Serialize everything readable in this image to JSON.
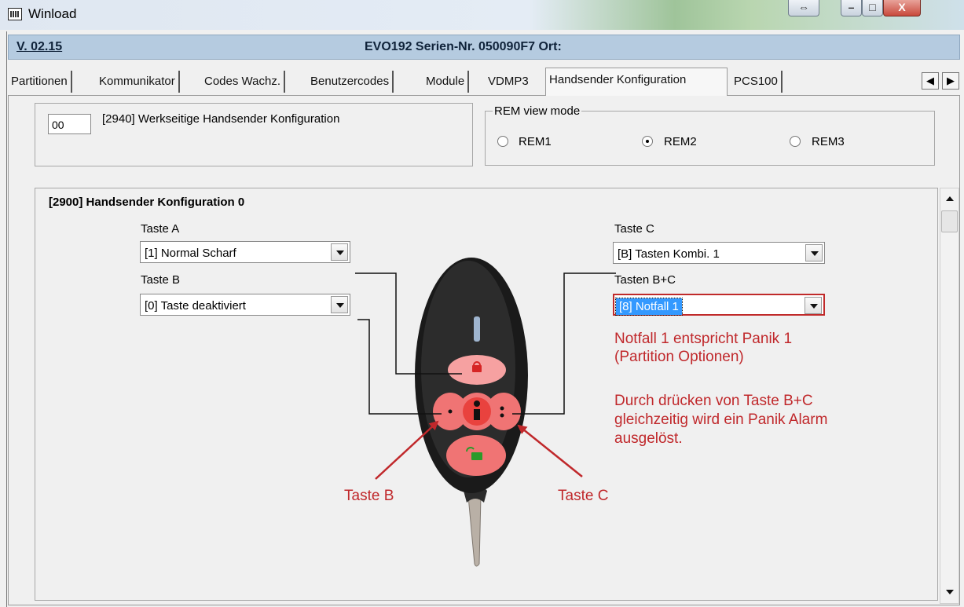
{
  "window": {
    "title": "Winload"
  },
  "header": {
    "version": "V. 02.15",
    "device": "EVO192  Serien-Nr. 050090F7 Ort:"
  },
  "tabs": [
    {
      "label": "Partitionen"
    },
    {
      "label": "Kommunikator"
    },
    {
      "label": "Codes Wachz."
    },
    {
      "label": "Benutzercodes"
    },
    {
      "label": "Module"
    },
    {
      "label": "VDMP3"
    },
    {
      "label": "Handsender Konfiguration",
      "active": true
    },
    {
      "label": "PCS100"
    }
  ],
  "factory": {
    "value": "00",
    "label": "[2940] Werkseitige Handsender Konfiguration"
  },
  "rem_mode": {
    "legend": "REM view mode",
    "options": [
      {
        "label": "REM1",
        "selected": false
      },
      {
        "label": "REM2",
        "selected": true
      },
      {
        "label": "REM3",
        "selected": false
      }
    ]
  },
  "config": {
    "title": "[2900] Handsender Konfiguration 0",
    "taste_a": {
      "label": "Taste A",
      "value": "[1] Normal Scharf"
    },
    "taste_b": {
      "label": "Taste B",
      "value": "[0] Taste deaktiviert"
    },
    "taste_c": {
      "label": "Taste C",
      "value": "[B] Tasten Kombi. 1"
    },
    "taste_bc": {
      "label": "Tasten B+C",
      "value": "[8] Notfall 1"
    }
  },
  "annotations": {
    "note1_line1": "Notfall 1 entspricht Panik 1",
    "note1_line2": "(Partition Optionen)",
    "note2_line1": "Durch drücken von Taste B+C",
    "note2_line2": "gleichzeitig wird ein Panik Alarm",
    "note2_line3": "ausgelöst.",
    "arrow_b": "Taste B",
    "arrow_c": "Taste C"
  },
  "colors": {
    "annotation": "#c0282b",
    "header_bg": "#b5cbe0",
    "selection": "#3399ff"
  }
}
